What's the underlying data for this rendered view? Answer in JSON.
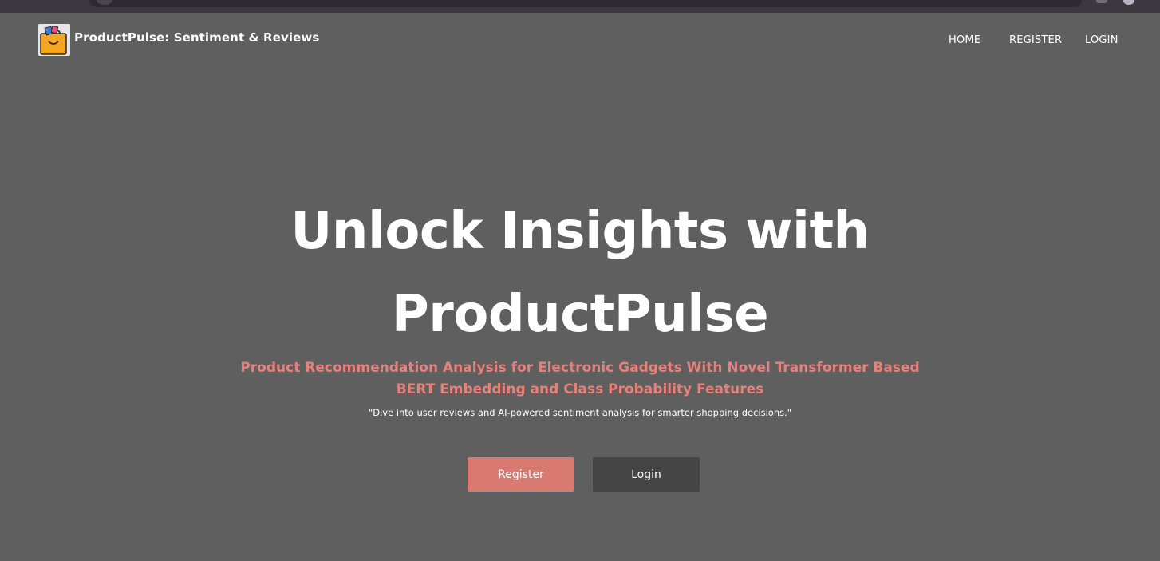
{
  "app": {
    "brand_title": "ProductPulse: Sentiment & Reviews",
    "brand_logo_icon": "shopping-bag-icon"
  },
  "nav": {
    "items": [
      {
        "label": "HOME",
        "active": true
      },
      {
        "label": "REGISTER",
        "active": false
      },
      {
        "label": "LOGIN",
        "active": false
      }
    ]
  },
  "hero": {
    "title_line1": "Unlock Insights with",
    "title_line2": "ProductPulse",
    "subtitle_line1": "Product Recommendation Analysis for Electronic Gadgets With Novel Transformer Based",
    "subtitle_line2": "BERT Embedding and Class Probability Features",
    "tagline": "\"Dive into user reviews and AI-powered sentiment analysis for smarter shopping decisions.\"",
    "register_button": "Register",
    "login_button": "Login"
  },
  "colors": {
    "background": "#5f5f5f",
    "nav_active": "#f2e31a",
    "accent": "#e8807a",
    "register_button": "#d97a72",
    "login_button": "#454545"
  }
}
